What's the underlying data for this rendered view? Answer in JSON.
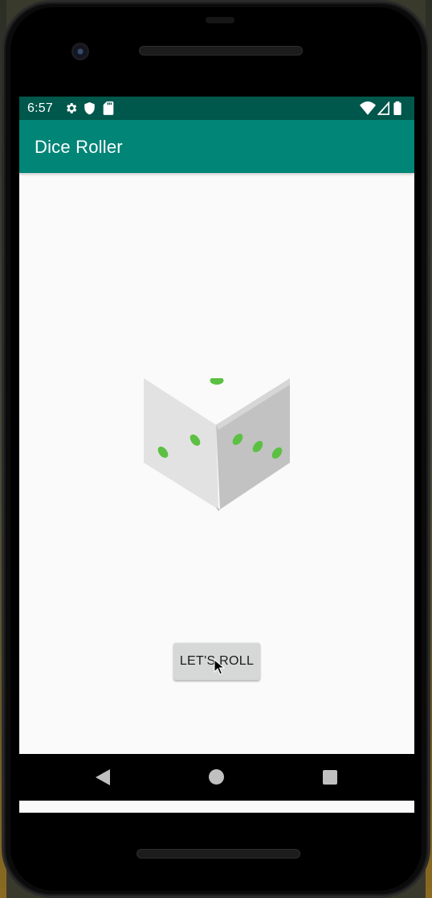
{
  "status_bar": {
    "time": "6:57",
    "left_icons": [
      "settings-gear-icon",
      "shield-icon",
      "sd-card-icon"
    ],
    "right_icons": [
      "wifi-icon",
      "cell-signal-icon",
      "battery-icon"
    ],
    "color": "#00574b"
  },
  "app_bar": {
    "title": "Dice Roller",
    "color": "#008577"
  },
  "main": {
    "dice_image": {
      "icon": "dice-icon",
      "pip_color": "#5cc042"
    },
    "roll_button": {
      "label": "LET'S ROLL"
    }
  },
  "navigation_bar": {
    "buttons": [
      "back-icon",
      "home-icon",
      "recents-icon"
    ]
  }
}
